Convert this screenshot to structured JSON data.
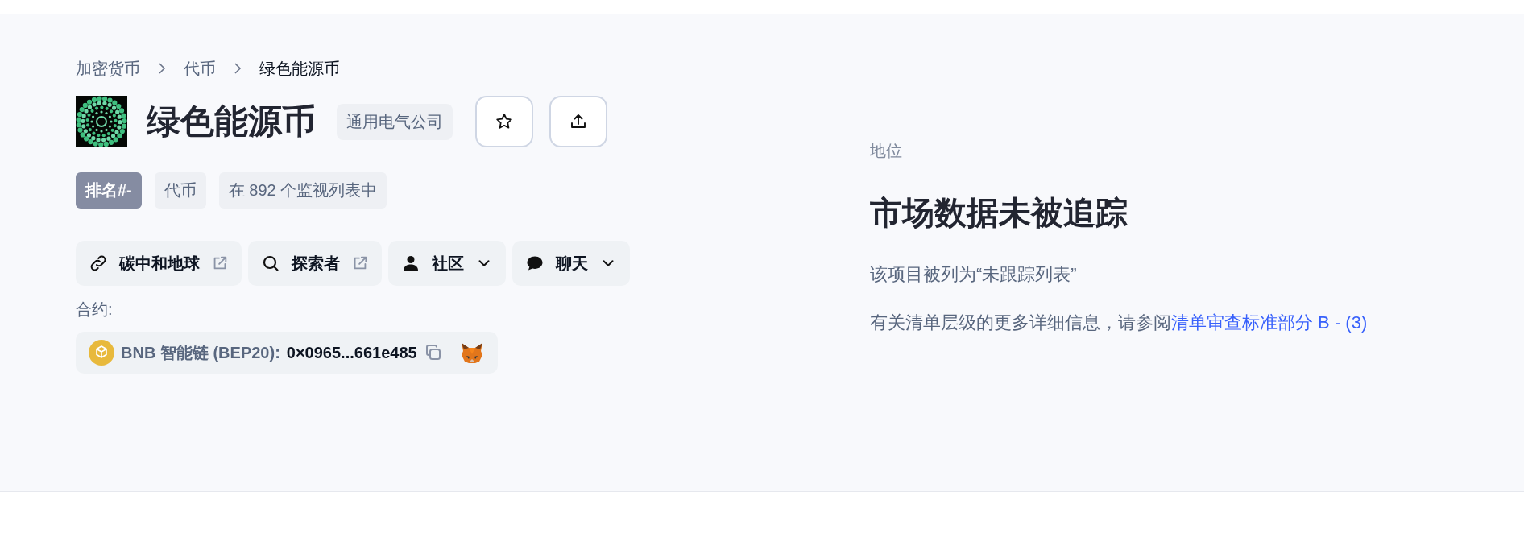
{
  "breadcrumb": [
    {
      "label": "加密货币",
      "current": false
    },
    {
      "label": "代币",
      "current": false
    },
    {
      "label": "绿色能源币",
      "current": true
    }
  ],
  "coin": {
    "name": "绿色能源币",
    "symbol": "通用电气公司"
  },
  "tags": [
    {
      "label": "排名#-",
      "kind": "rank"
    },
    {
      "label": "代币",
      "kind": "plain"
    },
    {
      "label": "在 892 个监视列表中",
      "kind": "plain"
    }
  ],
  "links": [
    {
      "label": "碳中和地球",
      "kind": "website"
    },
    {
      "label": "探索者",
      "kind": "explorer"
    },
    {
      "label": "社区",
      "kind": "community"
    },
    {
      "label": "聊天",
      "kind": "chat"
    }
  ],
  "contract": {
    "label": "合约:",
    "chain": "BNB 智能链 (BEP20):",
    "address": "0×0965...661e485"
  },
  "status": {
    "label": "地位",
    "heading": "市场数据未被追踪",
    "note": "该项目被列为“未跟踪列表”",
    "detail": "有关清单层级的更多详细信息，请参阅",
    "link": "清单审查标准部分 B - (3)"
  }
}
